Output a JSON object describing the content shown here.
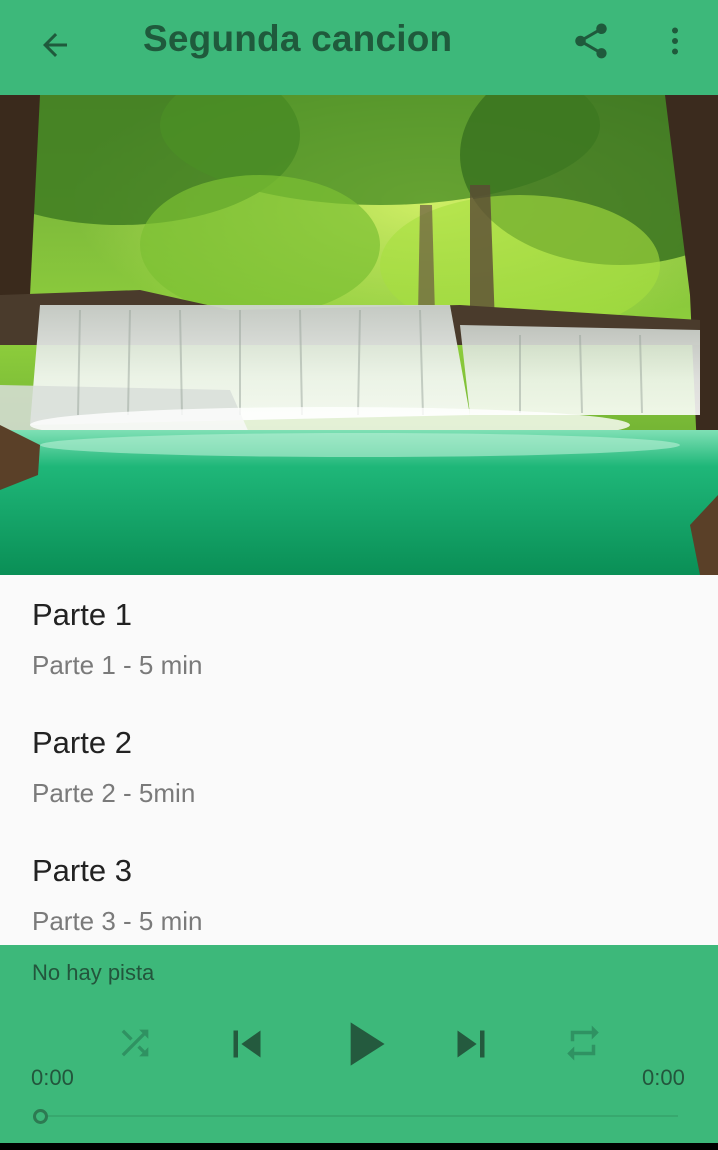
{
  "app_bar": {
    "title": "Segunda cancion",
    "back_icon": "arrow-left-icon",
    "share_icon": "share-icon",
    "more_icon": "more-vertical-icon"
  },
  "hero_image": {
    "description_icon": "waterfall-image"
  },
  "tracks": [
    {
      "title": "Parte 1",
      "subtitle": "Parte 1 - 5 min"
    },
    {
      "title": "Parte 2",
      "subtitle": "Parte 2 - 5min"
    },
    {
      "title": "Parte 3",
      "subtitle": "Parte 3 - 5 min"
    }
  ],
  "player": {
    "track_label": "No hay pista",
    "elapsed": "0:00",
    "duration": "0:00",
    "progress": 0
  },
  "colors": {
    "primary": "#3db87a",
    "primary_dark_text": "#1f5a3c"
  }
}
